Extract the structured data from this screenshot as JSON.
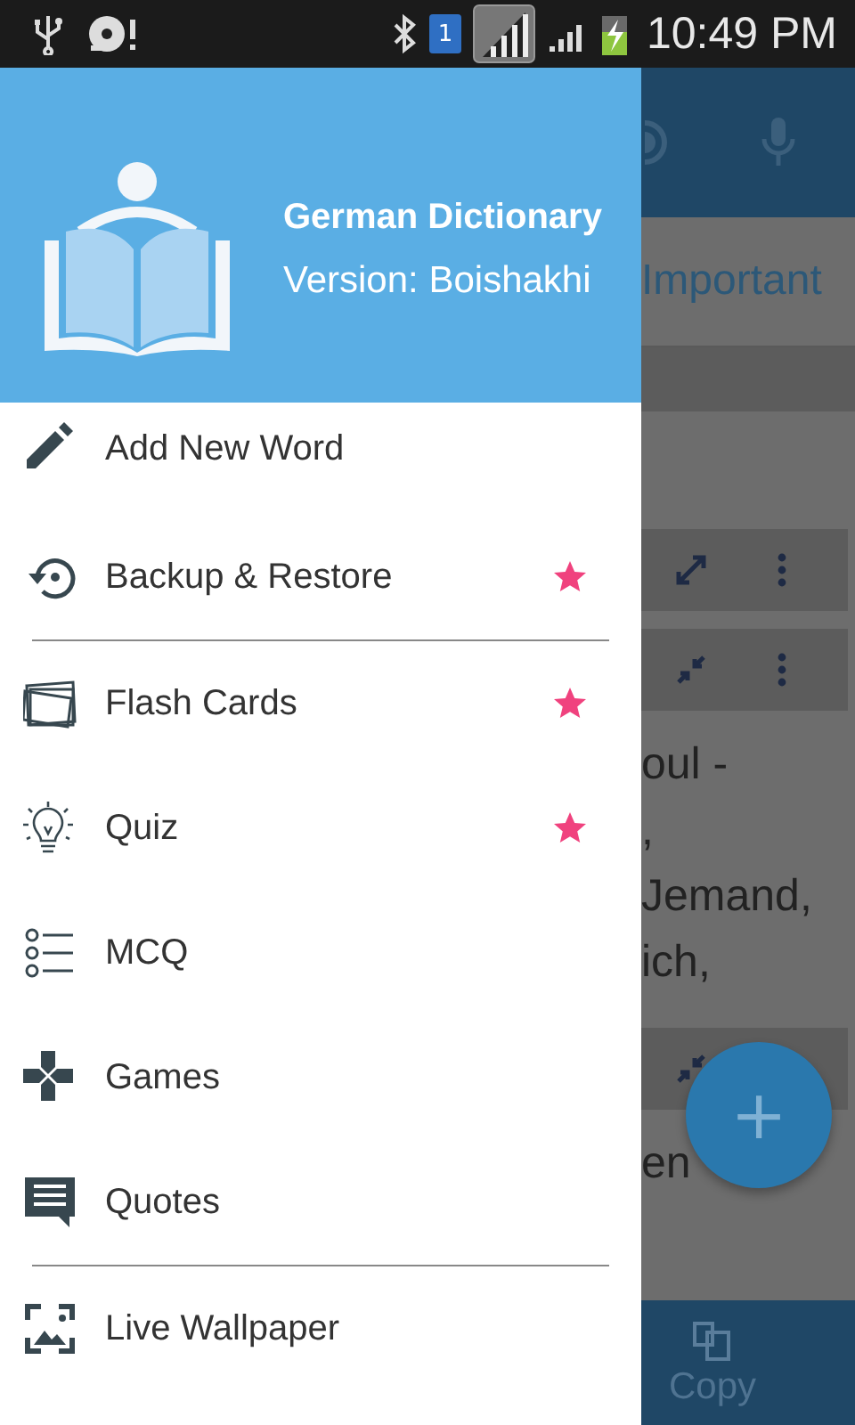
{
  "status_bar": {
    "time": "10:49 PM",
    "sim_slot": "1"
  },
  "drawer": {
    "title": "German Dictionary",
    "subtitle": "Version: Boishakhi",
    "items": [
      {
        "kind": "item",
        "label": "Add New Word",
        "starred": false
      },
      {
        "kind": "item",
        "label": "Backup & Restore",
        "starred": true
      },
      {
        "kind": "divider"
      },
      {
        "kind": "item",
        "label": "Flash Cards",
        "starred": true
      },
      {
        "kind": "item",
        "label": "Quiz",
        "starred": true
      },
      {
        "kind": "item",
        "label": "MCQ",
        "starred": false
      },
      {
        "kind": "item",
        "label": "Games",
        "starred": false
      },
      {
        "kind": "item",
        "label": "Quotes",
        "starred": false
      },
      {
        "kind": "divider"
      },
      {
        "kind": "item",
        "label": "Live Wallpaper",
        "starred": false
      }
    ]
  },
  "background": {
    "tab_label": "Important",
    "text_lines": [
      "oul -",
      ",",
      "Jemand,",
      "ich,"
    ],
    "last_text": "en",
    "fab": "+",
    "bottom_action": "Copy"
  }
}
